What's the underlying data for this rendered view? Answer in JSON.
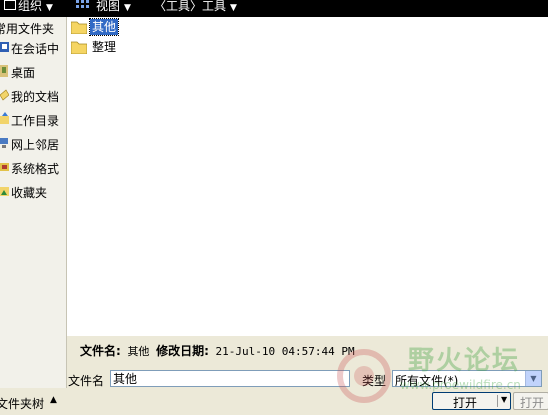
{
  "toolbar": {
    "organize_label": "组织",
    "views_label": "视图",
    "tools_label": "〈工具〉工具"
  },
  "sidebar": {
    "header": "常用文件夹",
    "items": [
      {
        "label": "在会话中",
        "icon": "session-icon"
      },
      {
        "label": "桌面",
        "icon": "desktop-icon"
      },
      {
        "label": "我的文档",
        "icon": "documents-icon"
      },
      {
        "label": "工作目录",
        "icon": "work-dir-icon"
      },
      {
        "label": "网上邻居",
        "icon": "network-icon"
      },
      {
        "label": "系统格式",
        "icon": "system-format-icon"
      },
      {
        "label": "收藏夹",
        "icon": "favorites-icon"
      }
    ]
  },
  "files": [
    {
      "name": "其他",
      "selected": true,
      "icon": "folder-icon"
    },
    {
      "name": "整理",
      "selected": false,
      "icon": "folder-icon"
    }
  ],
  "info": {
    "filename_label": "文件名:",
    "filename_value": "其他",
    "modified_label": "修改日期:",
    "modified_value": "21-Jul-10 04:57:44 PM"
  },
  "form": {
    "filename_label": "文件名",
    "filename_value": "其他",
    "type_label": "类型",
    "type_value": "所有文件(*)"
  },
  "status": {
    "folder_tree_label": "文件夹树"
  },
  "buttons": {
    "open_label": "打开",
    "open2_label": "打开"
  },
  "watermark": {
    "text": "野火论坛",
    "url": "www.proewildfire.cn"
  },
  "colors": {
    "selection": "#316ac5",
    "folder": "#f5d564",
    "toolbar_bg": "#000000"
  }
}
